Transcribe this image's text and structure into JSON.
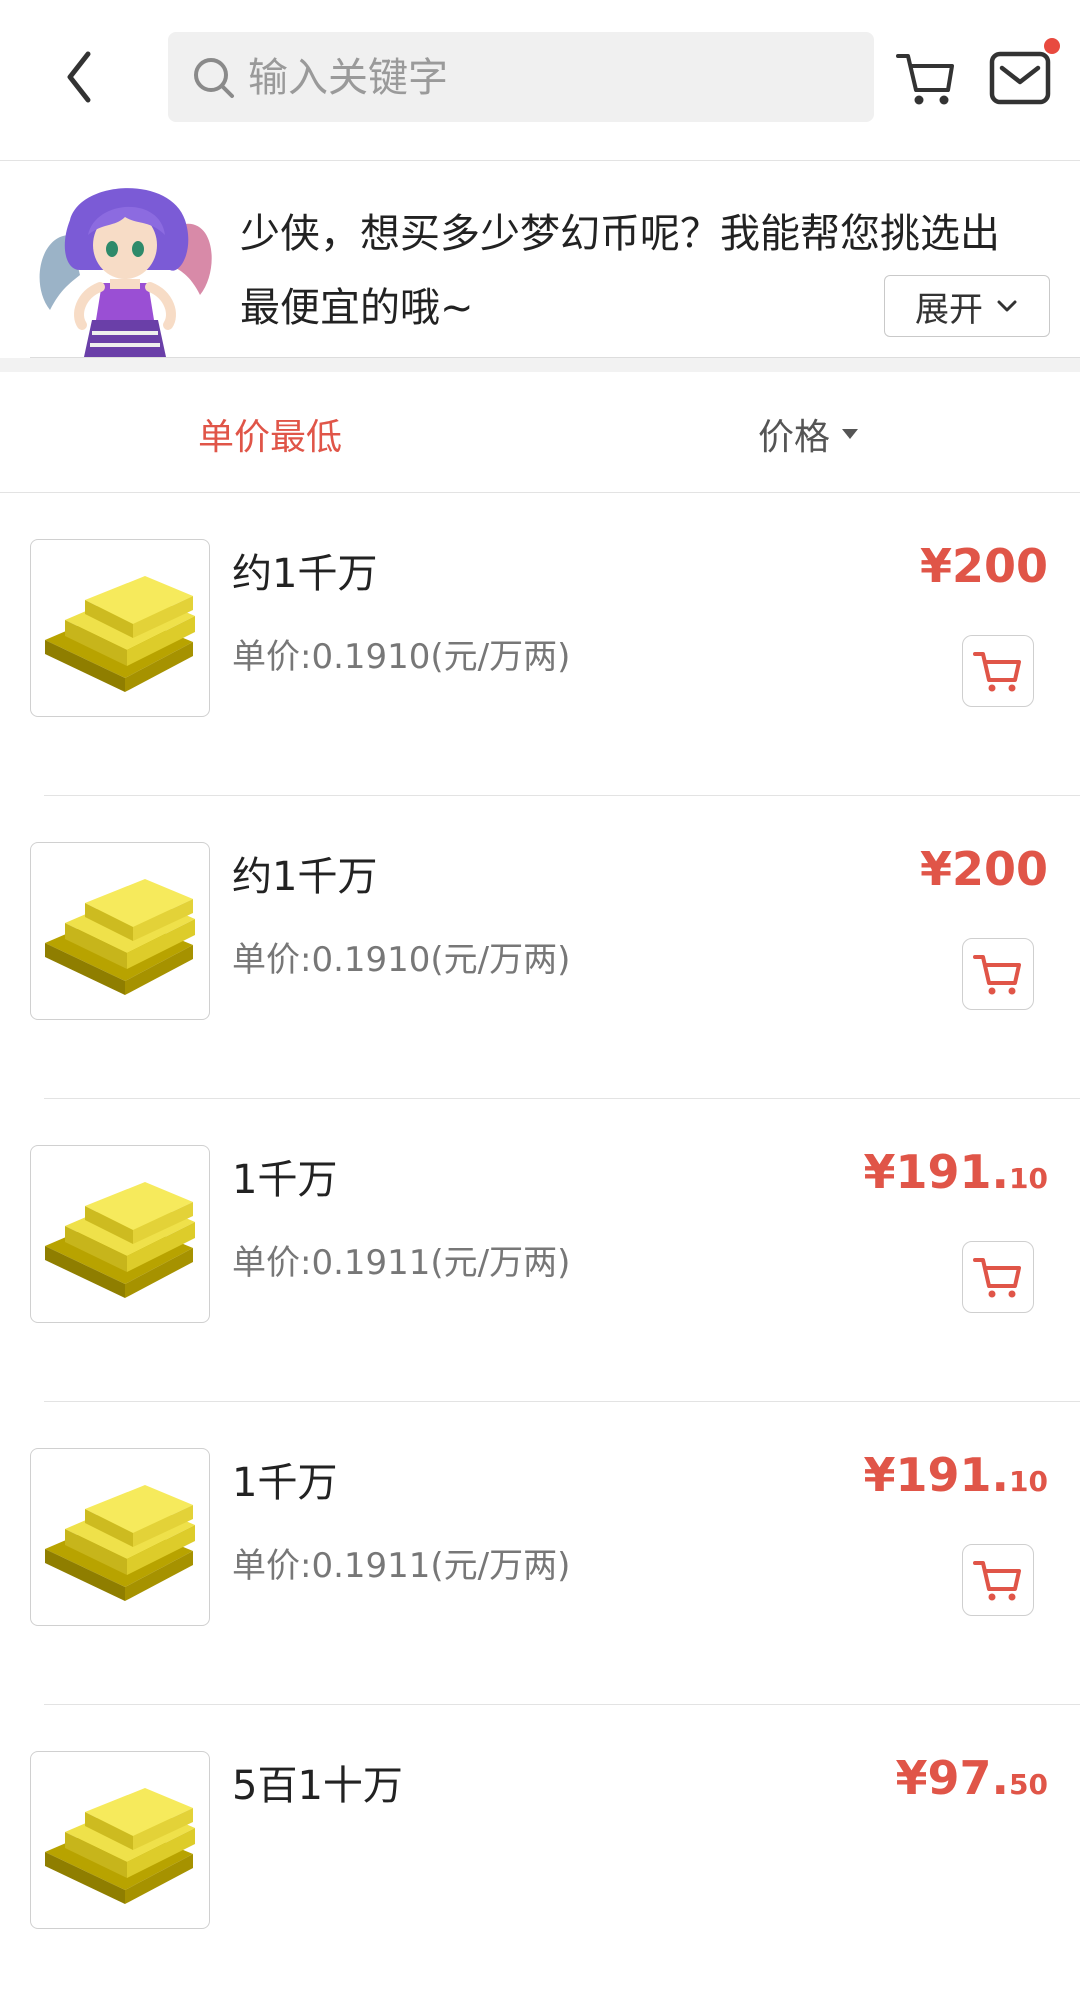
{
  "header": {
    "search_placeholder": "输入关键字"
  },
  "banner": {
    "message_line1": "少侠，想买多少梦幻币呢？我能帮您挑选出",
    "message_line2": "最便宜的哦~",
    "expand_label": "展开"
  },
  "sort": {
    "unit_lowest": "单价最低",
    "price": "价格"
  },
  "colors": {
    "accent": "#e05548",
    "notification_dot": "#e84a3f"
  },
  "items": [
    {
      "title": "约1千万",
      "unit_price": "单价:0.1910(元/万两)",
      "price_main": "¥200",
      "price_decimal": ""
    },
    {
      "title": "约1千万",
      "unit_price": "单价:0.1910(元/万两)",
      "price_main": "¥200",
      "price_decimal": ""
    },
    {
      "title": "1千万",
      "unit_price": "单价:0.1911(元/万两)",
      "price_main": "¥191.",
      "price_decimal": "10"
    },
    {
      "title": "1千万",
      "unit_price": "单价:0.1911(元/万两)",
      "price_main": "¥191.",
      "price_decimal": "10"
    },
    {
      "title": "5百1十万",
      "unit_price": "",
      "price_main": "¥97.",
      "price_decimal": "50"
    }
  ]
}
